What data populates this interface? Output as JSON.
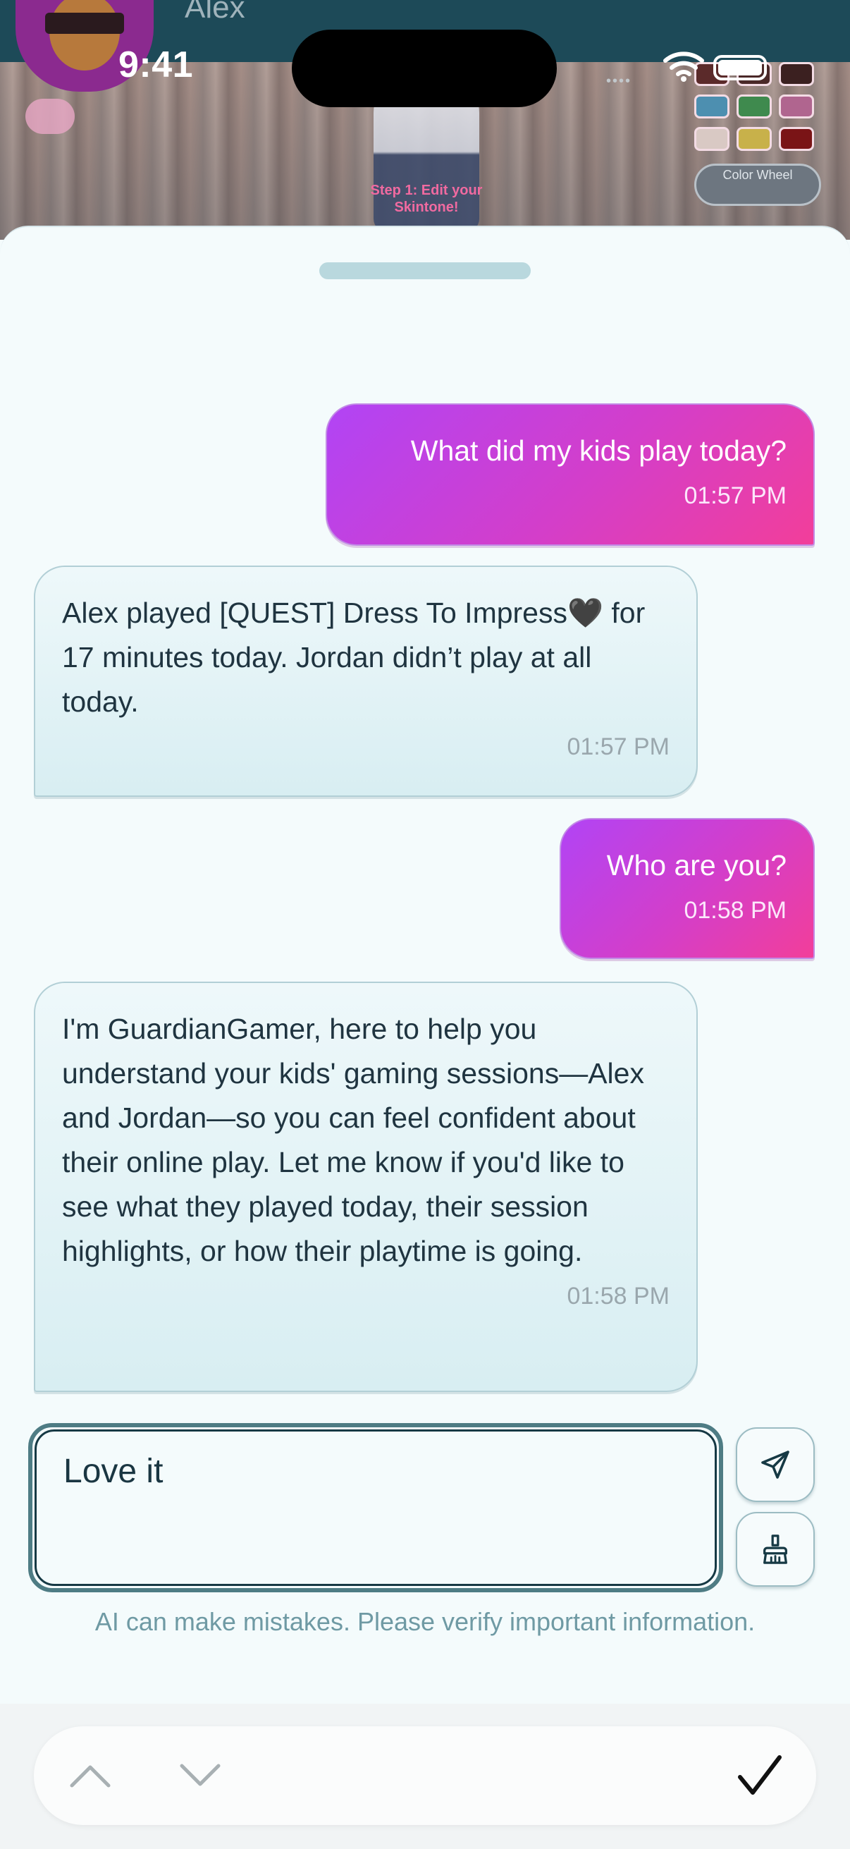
{
  "background": {
    "user_name": "Alex",
    "step_text": "Step 1: Edit your Skintone!",
    "color_wheel_label": "Color Wheel"
  },
  "status_bar": {
    "time": "9:41"
  },
  "messages": [
    {
      "role": "user",
      "text": "What did my kids play today?",
      "time": "01:57 PM"
    },
    {
      "role": "assistant",
      "text": "Alex played [QUEST] Dress To Impress🖤 for 17 minutes today. Jordan didn’t play at all today.",
      "time": "01:57 PM"
    },
    {
      "role": "user",
      "text": "Who are you?",
      "time": "01:58 PM"
    },
    {
      "role": "assistant",
      "text": "I'm GuardianGamer, here to help you understand your kids' gaming sessions—Alex and Jordan—so you can feel confident about their online play. Let me know if you'd like to see what they played today, their session highlights, or how their playtime is going.",
      "time": "01:58 PM"
    }
  ],
  "composer": {
    "value": "Love it"
  },
  "disclaimer": "AI can make mistakes. Please verify important information.",
  "icons": {
    "send": "send-icon",
    "clear": "broom-icon",
    "prev": "chevron-up-icon",
    "next": "chevron-down-icon",
    "done": "checkmark-icon"
  },
  "colors": {
    "user_bubble_start": "#b144f5",
    "user_bubble_end": "#f23e9a",
    "bot_bubble": "#e3f3f6",
    "accent_dark": "#163944"
  }
}
